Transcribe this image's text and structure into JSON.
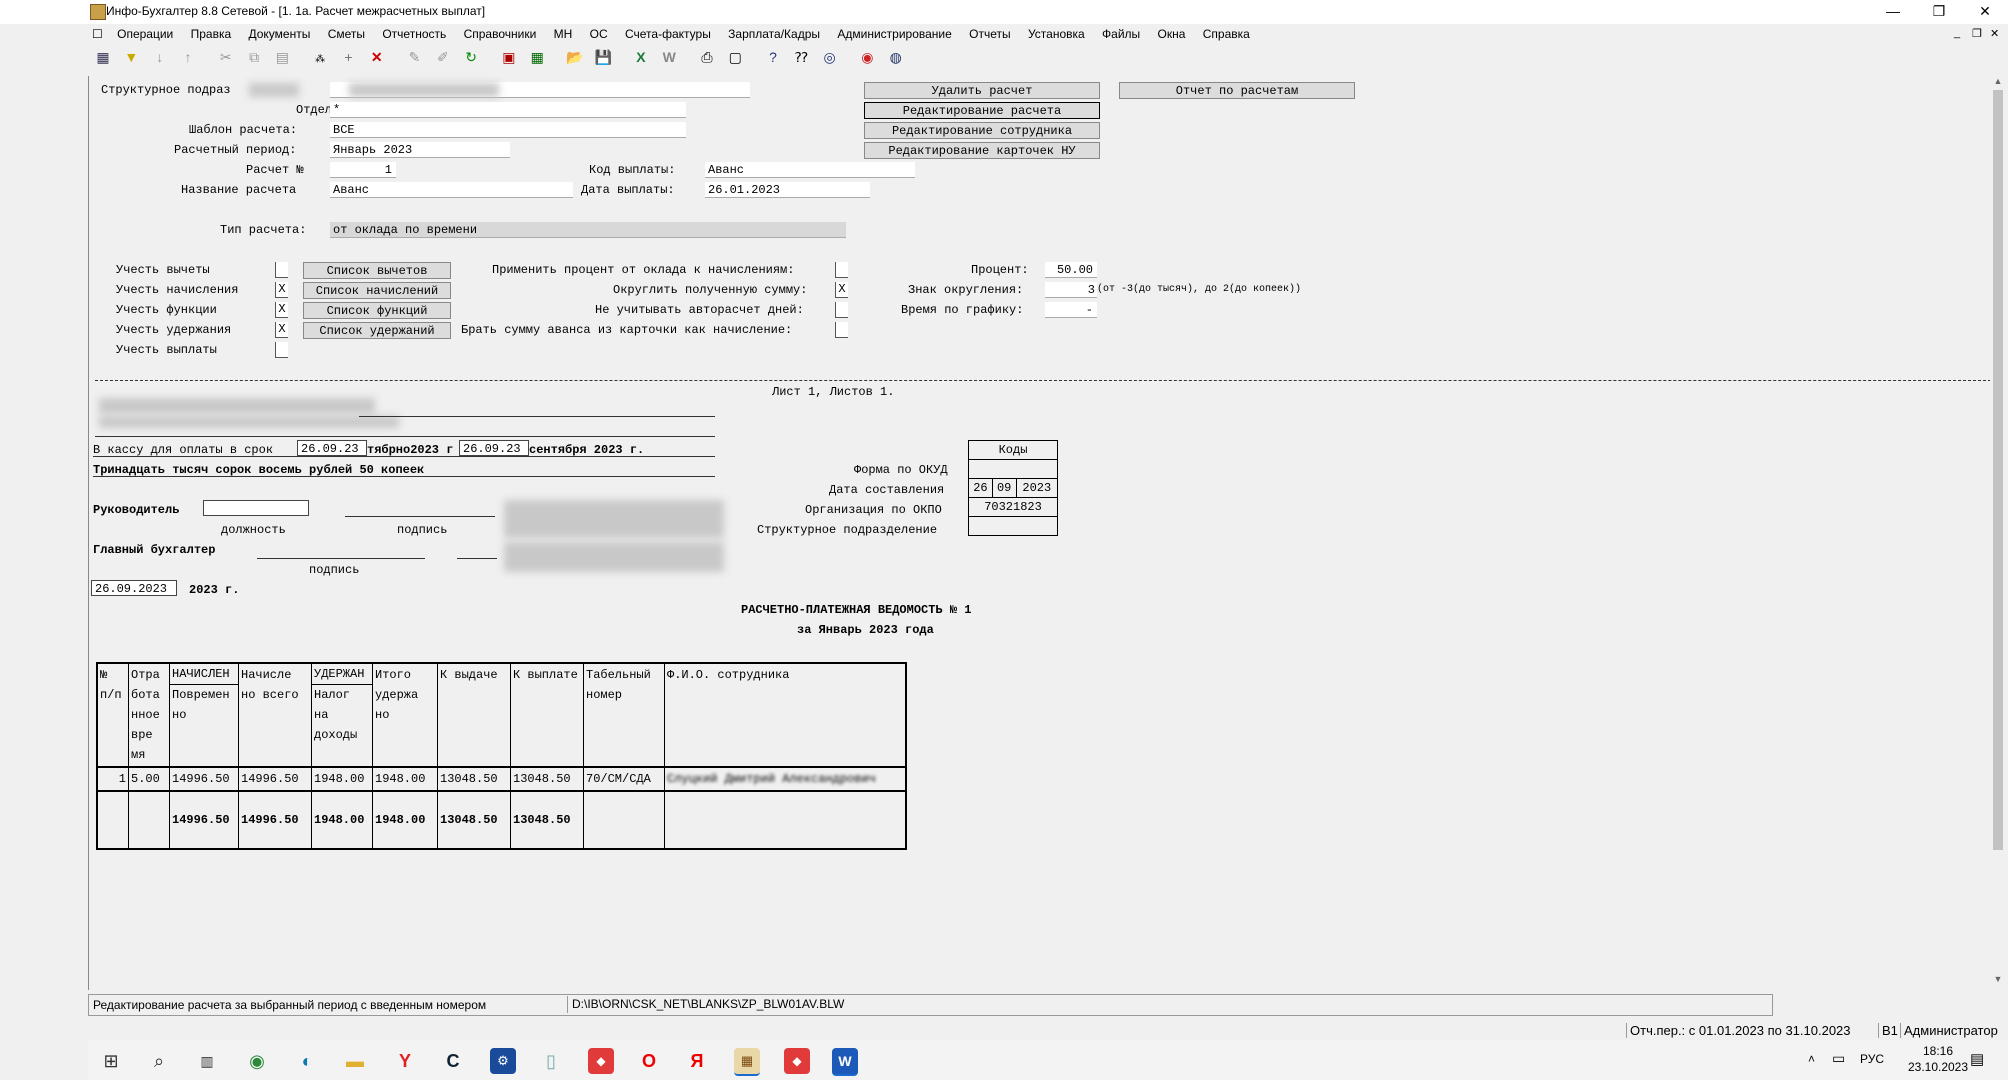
{
  "window": {
    "title": "Инфо-Бухгалтер 8.8 Сетевой - [1. 1а. Расчет межрасчетных выплат]",
    "minimize": "—",
    "maximize": "❐",
    "close": "✕"
  },
  "menu": [
    "Операции",
    "Правка",
    "Документы",
    "Сметы",
    "Отчетность",
    "Справочники",
    "МН",
    "ОС",
    "Счета-фактуры",
    "Зарплата/Кадры",
    "Администрирование",
    "Отчеты",
    "Установка",
    "Файлы",
    "Окна",
    "Справка"
  ],
  "form": {
    "labels": {
      "dept_struct": "Структурное подраз",
      "otdel": "Отдел:",
      "template": "Шаблон расчета:",
      "period": "Расчетный период:",
      "calc_no": "Расчет №",
      "calc_name": "Название расчета",
      "pay_code": "Код выплаты:",
      "pay_date": "Дата выплаты:",
      "calc_type": "Тип расчета:",
      "use_deductions": "Учесть вычеты",
      "use_accruals": "Учесть начисления",
      "use_functions": "Учесть функции",
      "use_withholdings": "Учесть удержания",
      "use_payments": "Учесть выплаты",
      "apply_percent": "Применить процент от оклада к начислениям:",
      "round_sum": "Округлить полученную сумму:",
      "ignore_autocalc": "Не учитывать авторасчет дней:",
      "take_advance": "Брать сумму аванса из карточки как начисление:",
      "percent": "Процент:",
      "round_sign": "Знак округления:",
      "round_hint": "(от -3(до тысяч), до 2(до копеек))",
      "time_by_schedule": "Время по графику:"
    },
    "values": {
      "otdel": "*",
      "template": "ВСЕ",
      "period": "Январь 2023",
      "calc_no": "1",
      "calc_name": "Аванс",
      "pay_code": "Аванс",
      "pay_date": "26.01.2023",
      "calc_type": "от оклада по времени",
      "percent": "50.00",
      "round_sign": "3",
      "time_by_schedule": "-"
    },
    "checks": {
      "use_deductions": "",
      "use_accruals": "X",
      "use_functions": "X",
      "use_withholdings": "X",
      "use_payments": "",
      "apply_percent": "",
      "round_sum": "X",
      "ignore_autocalc": "",
      "take_advance": ""
    },
    "buttons": {
      "delete_calc": "Удалить расчет",
      "edit_calc": "Редактирование расчета",
      "edit_employee": "Редактирование сотрудника",
      "edit_cards": "Редактирование карточек НУ",
      "report": "Отчет по расчетам",
      "list_deductions": "Список вычетов",
      "list_accruals": "Список начислений",
      "list_functions": "Список функций",
      "list_withholdings": "Список удержаний"
    }
  },
  "sheet": {
    "sheet_info": "Лист 1, Листов 1.",
    "cash_label": "В кассу для оплаты в срок",
    "cash_from": "26.09.23",
    "cash_mid": "тябрно2023 г",
    "cash_to": "26.09.23",
    "cash_end": "сентября 2023 г.",
    "amount_words": "Тринадцать тысяч сорок восемь рублей 50 копеек",
    "head_label": "Руководитель",
    "position_label": "должность",
    "sign_label": "подпись",
    "chief_acc_label": "Главный бухгалтер",
    "sign_label2": "подпись",
    "date_value": "26.09.2023",
    "date_suffix": "2023 г.",
    "codes_header": "Коды",
    "okud_label": "Форма по ОКУД",
    "date_composed_label": "Дата составления",
    "okpo_label": "Организация по ОКПО",
    "struct_label": "Структурное подразделение",
    "date_d": "26",
    "date_m": "09",
    "date_y": "2023",
    "okpo": "70321823",
    "doc_title": "РАСЧЕТНО-ПЛАТЕЖНАЯ ВЕДОМОСТЬ № 1",
    "doc_subtitle": "за Январь 2023 года"
  },
  "table": {
    "headers": {
      "num": "№ п/п",
      "worked": "Отра бота нное вре мя",
      "accrued_top": "НАЧИСЛЕН",
      "accrued_sub": "Повремен но",
      "accrued_total": "Начисле но всего",
      "withheld_top": "УДЕРЖАН",
      "withheld_sub": "Налог на доходы",
      "withheld_total": "Итого удержа но",
      "to_issue": "К выдаче",
      "to_pay": "К выплате",
      "tab_no": "Табельный номер",
      "fio": "Ф.И.О. сотрудника"
    },
    "rows": [
      {
        "num": "1",
        "worked": "5.00",
        "accrued": "14996.50",
        "accrued_total": "14996.50",
        "tax": "1948.00",
        "withheld_total": "1948.00",
        "to_issue": "13048.50",
        "to_pay": "13048.50",
        "tab_no": "70/СМ/СДА",
        "fio": "Слуцкий Дмитрий Александрович"
      }
    ],
    "totals": {
      "accrued": "14996.50",
      "accrued_total": "14996.50",
      "tax": "1948.00",
      "withheld_total": "1948.00",
      "to_issue": "13048.50",
      "to_pay": "13048.50"
    }
  },
  "status": {
    "hint": "Редактирование расчета за выбранный период с введенным номером",
    "path": "D:\\IB\\ORN\\CSK_NET\\BLANKS\\ZP_BLW01AV.BLW",
    "period": "Отч.пер.: с 01.01.2023 по 31.10.2023",
    "level": "В1",
    "user": "Администратор"
  },
  "taskbar": {
    "lang": "РУС",
    "time": "18:16",
    "date": "23.10.2023"
  }
}
